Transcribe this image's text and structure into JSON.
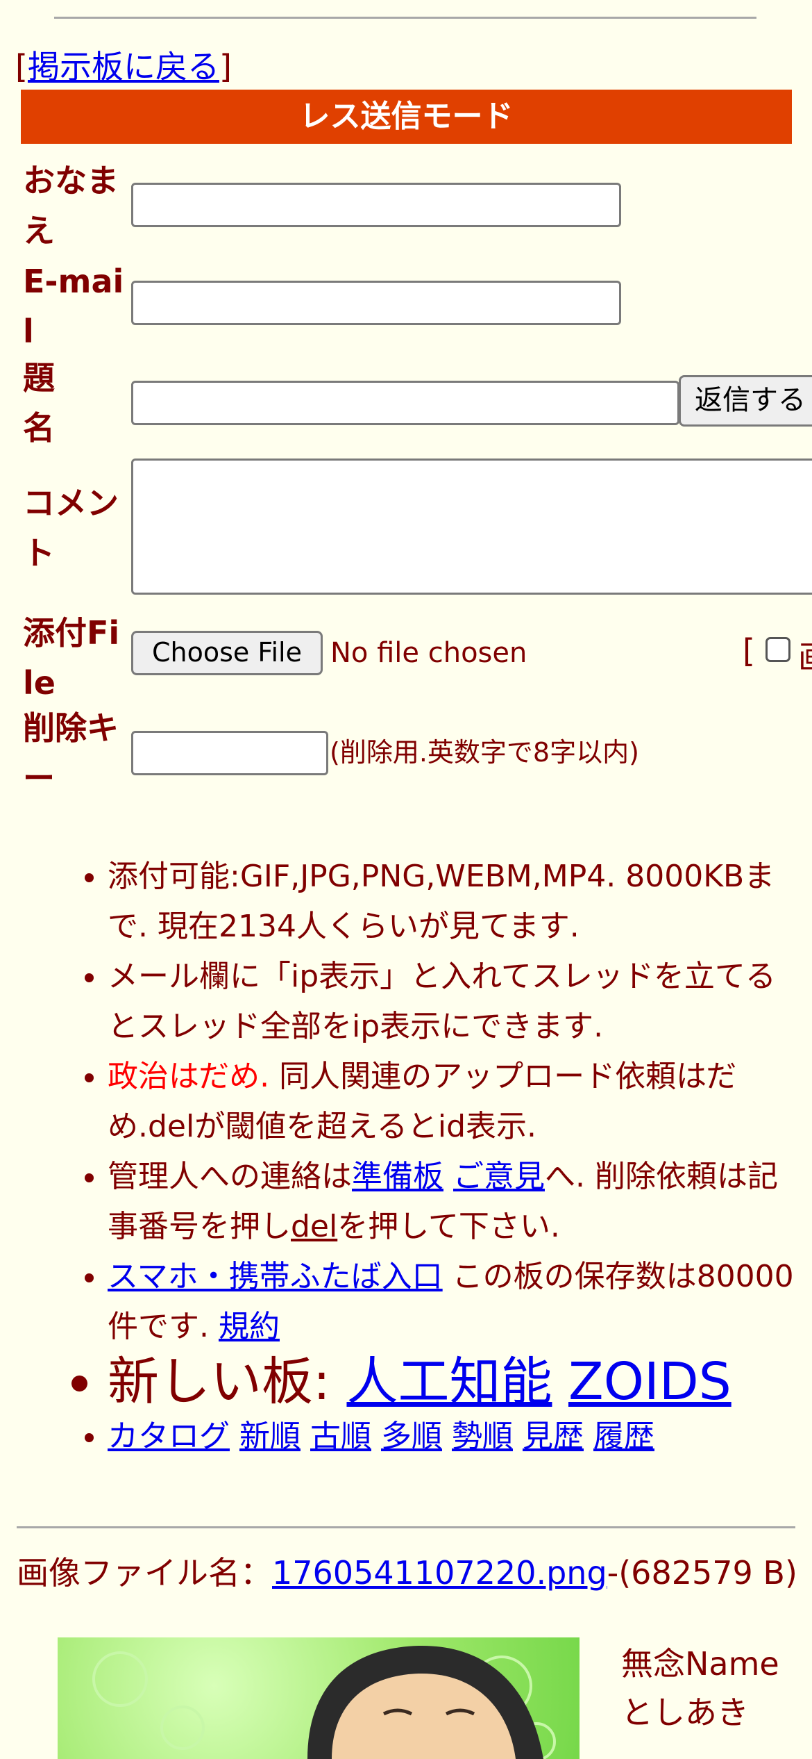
{
  "nav": {
    "back_prefix": "[",
    "back_link": "掲示板に戻る",
    "back_suffix": "]"
  },
  "mode_title": "レス送信モード",
  "form": {
    "name_label": "おなまえ",
    "email_label": "E-mail",
    "subject_label": "題名",
    "submit_label": "返信する",
    "comment_label": "コメント",
    "file_label": "添付File",
    "choose_file_label": "Choose File",
    "no_file_text": "No file chosen",
    "image_option_prefix": "[",
    "image_option_clipped": "画",
    "delkey_label": "削除キー",
    "delkey_note": "(削除用.英数字で8字以内)"
  },
  "rules": {
    "r1": "添付可能:GIF,JPG,PNG,WEBM,MP4. 8000KBまで. 現在2134人くらいが見てます.",
    "r2": "メール欄に「ip表示」と入れてスレッドを立てるとスレッド全部をip表示にできます.",
    "r3_red": "政治はだめ.",
    "r3_rest": " 同人関連のアップロード依頼はだめ.delが閾値を超えるとid表示.",
    "r4_a": "管理人への連絡は",
    "r4_link1": "準備板",
    "r4_link2": "ご意見",
    "r4_b": "へ. 削除依頼は記事番号を押し",
    "r4_link3": "del",
    "r4_c": "を押して下さい.",
    "r5_link": "スマホ・携帯ふたば入口",
    "r5_text": " この板の保存数は80000件です.",
    "r5_link2": "規約",
    "new_boards_label": "新しい板:",
    "new_board_1": "人工知能",
    "new_board_2": "ZOIDS",
    "sort_links": [
      "カタログ",
      "新順",
      "古順",
      "多順",
      "勢順",
      "見歴",
      "履歴"
    ]
  },
  "post": {
    "file_label": "画像ファイル名：",
    "file_link": "1760541107220.png",
    "file_size": "-(682579 B)",
    "name": "無念Name",
    "name2": "としあき"
  },
  "colors": {
    "background": "#ffffee",
    "text": "#800000",
    "accent_bar": "#e04000",
    "link": "#0000ee",
    "warning": "#ff0000"
  }
}
